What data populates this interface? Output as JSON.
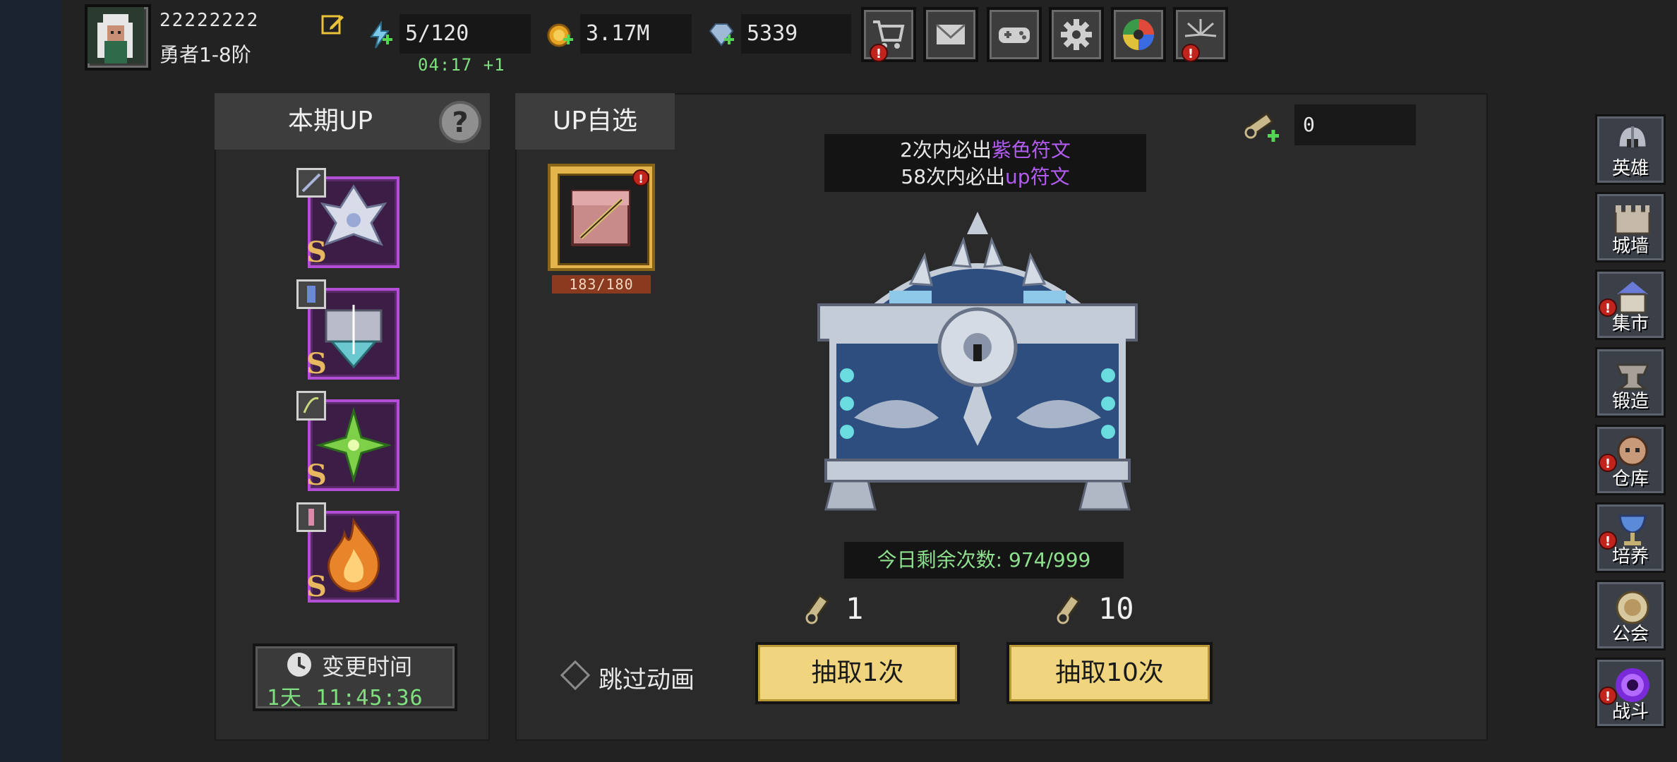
{
  "header": {
    "player_name": "22222222",
    "player_rank": "勇者1-8阶",
    "stamina": "5/120",
    "stamina_timer": "04:17 +1",
    "gold": "3.17M",
    "gems": "5339"
  },
  "top_buttons": [
    {
      "icon": "shop-cart-icon",
      "alert": true
    },
    {
      "icon": "mail-icon",
      "alert": false
    },
    {
      "icon": "gamepad-icon",
      "alert": false
    },
    {
      "icon": "gear-icon",
      "alert": false
    },
    {
      "icon": "color-wheel-icon",
      "alert": false
    },
    {
      "icon": "fireworks-icon",
      "alert": true
    }
  ],
  "up_panel": {
    "title": "本期UP",
    "help_symbol": "?",
    "runes": [
      {
        "grade": "S",
        "color": "silver"
      },
      {
        "grade": "S",
        "color": "silver-teal"
      },
      {
        "grade": "S",
        "color": "green"
      },
      {
        "grade": "S",
        "color": "orange"
      }
    ],
    "change_label": "变更时间",
    "change_time": "1天 11:45:36"
  },
  "main_panel": {
    "tab_label": "UP自选",
    "pick_progress": "183/180",
    "pick_alert": "!",
    "pity_line1_prefix": "2次内必出",
    "pity_line1_highlight": "紫色符文",
    "pity_line2_prefix": "58次内必出",
    "pity_line2_highlight": "up符文",
    "key_count": "0",
    "remaining_label": "今日剩余次数:",
    "remaining_value": "974/999",
    "cost_single": "1",
    "cost_ten": "10",
    "skip_label": "跳过动画",
    "draw_single_label": "抽取1次",
    "draw_ten_label": "抽取10次"
  },
  "nav": [
    {
      "label": "英雄",
      "icon": "helmet-icon",
      "alert": false
    },
    {
      "label": "城墙",
      "icon": "wall-icon",
      "alert": false
    },
    {
      "label": "集市",
      "icon": "market-icon",
      "alert": true
    },
    {
      "label": "锻造",
      "icon": "anvil-icon",
      "alert": false
    },
    {
      "label": "仓库",
      "icon": "storage-icon",
      "alert": true
    },
    {
      "label": "培养",
      "icon": "chalice-icon",
      "alert": true
    },
    {
      "label": "公会",
      "icon": "guild-icon",
      "alert": false
    },
    {
      "label": "战斗",
      "icon": "portal-icon",
      "alert": true
    }
  ],
  "colors": {
    "accent_purple": "#b25cf0",
    "timer_green": "#7ee07e",
    "button_yellow": "#f0d57e",
    "rune_border": "#b24fd6"
  }
}
